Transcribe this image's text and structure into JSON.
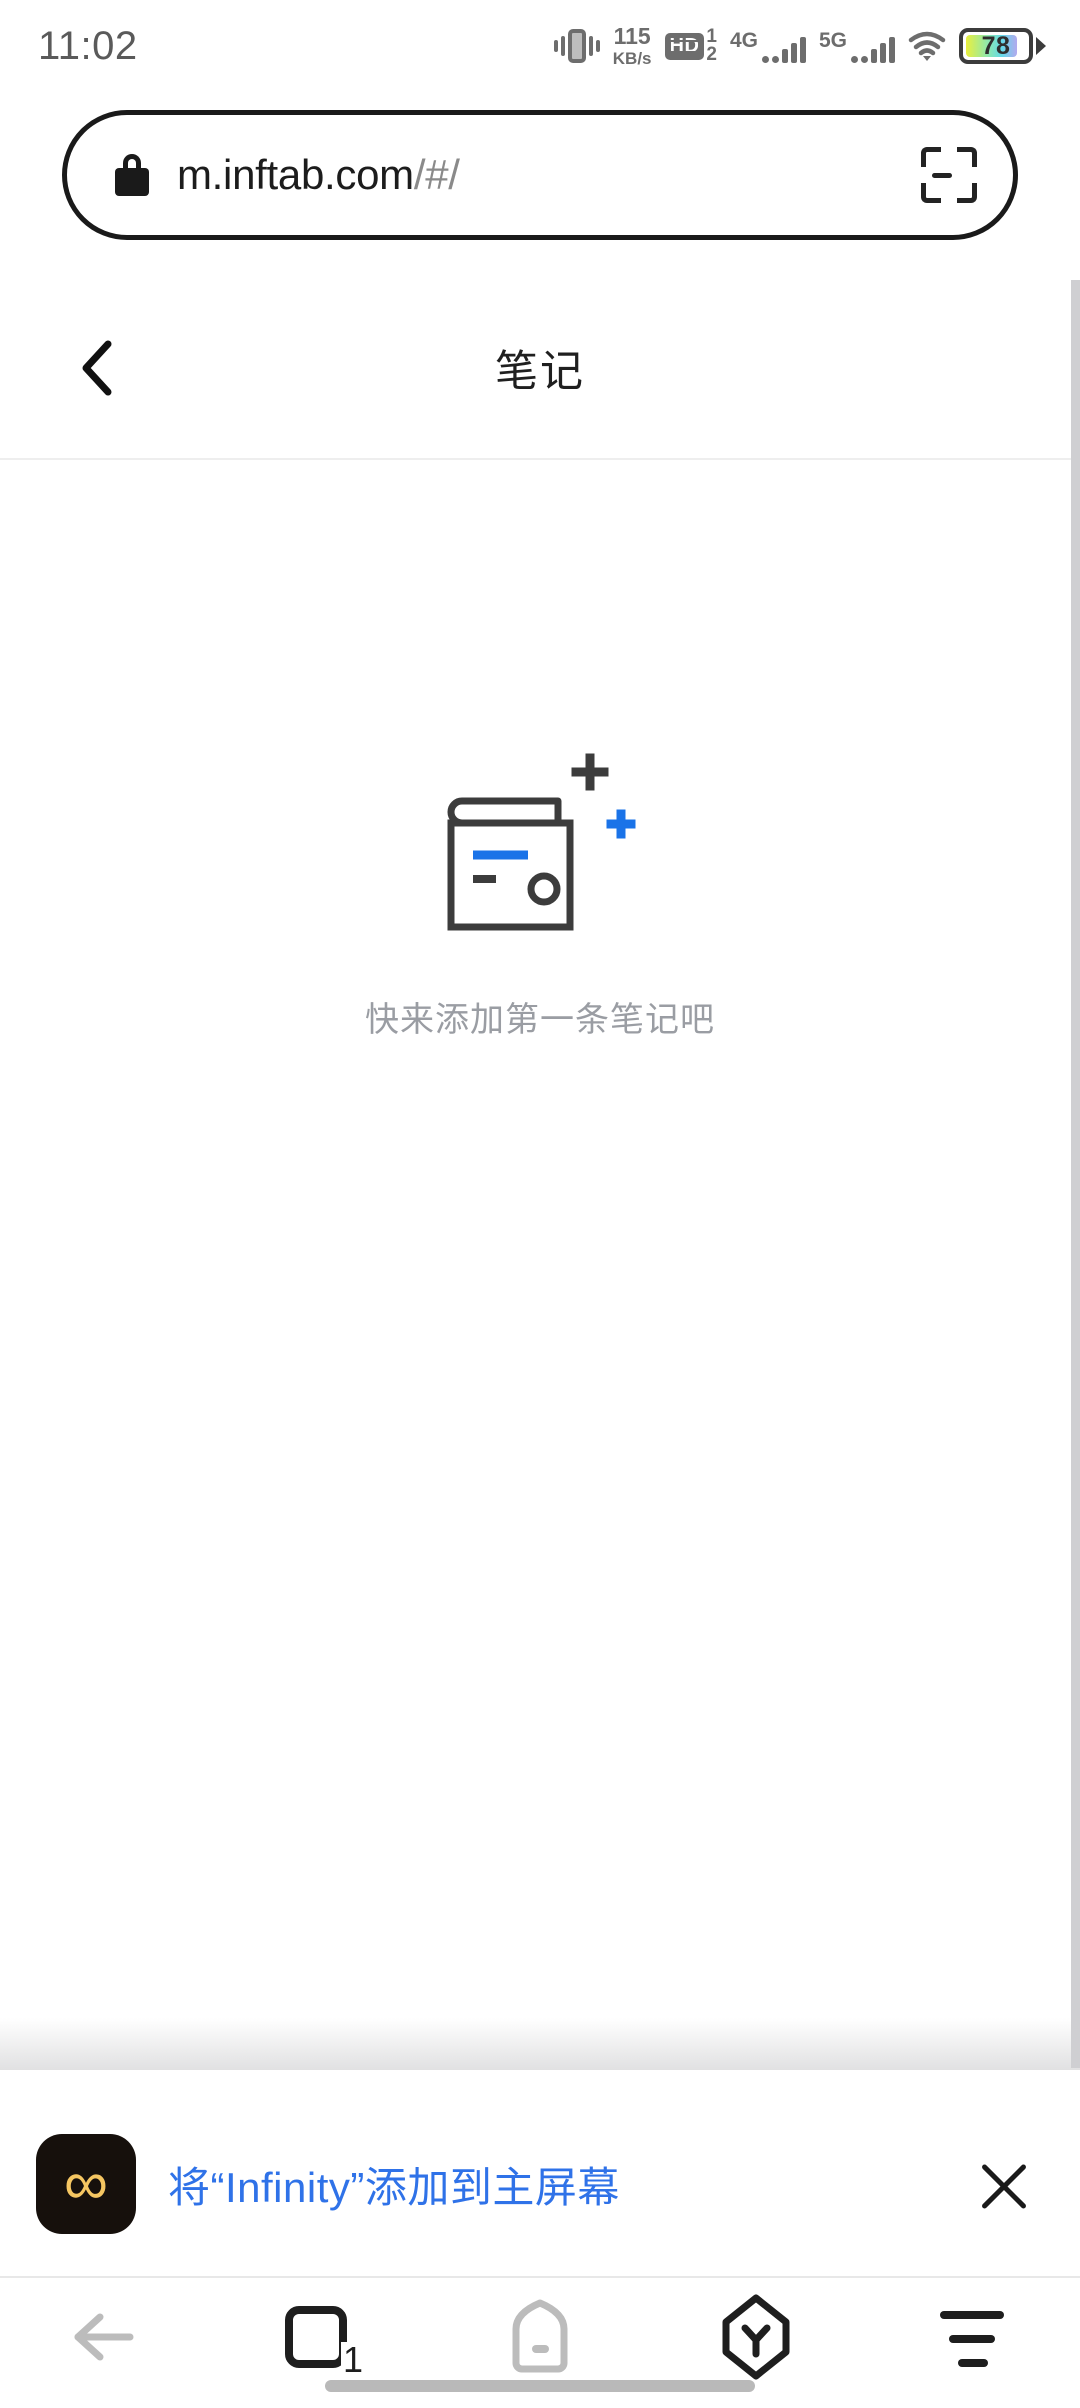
{
  "status_bar": {
    "time": "11:02",
    "network_speed_value": "115",
    "network_speed_unit": "KB/s",
    "hd_label": "HD",
    "hd_sim_top": "1",
    "hd_sim_bottom": "2",
    "sim1_network": "4G",
    "sim2_network": "5G",
    "battery_percent": "78",
    "icons": [
      "vibrate-icon",
      "network-speed-icon",
      "hd-voice-icon",
      "signal-4g-icon",
      "signal-5g-icon",
      "wifi-icon",
      "battery-icon"
    ]
  },
  "url_bar": {
    "lock_icon": "lock-icon",
    "domain": "m.inftab.com",
    "path": "/#/",
    "scan_icon": "scan-qr-icon"
  },
  "page": {
    "back_icon": "back-chevron-icon",
    "title": "笔记",
    "empty_state": {
      "illustration": "empty-notebook-icon",
      "message": "快来添加第一条笔记吧",
      "accent_color": "#1a73e8",
      "line_color": "#3c3c3c",
      "text_color": "#9a9da3"
    }
  },
  "a2hs_banner": {
    "app_icon": "infinity-app-icon",
    "app_icon_glyph": "∞",
    "app_icon_bg": "#16100c",
    "app_icon_fg": "#f5c662",
    "message": "将“Infinity”添加到主屏幕",
    "message_color": "#2f72e8",
    "close_icon": "close-icon"
  },
  "browser_nav": {
    "back_icon": "back-arrow-icon",
    "tabs_icon": "tabs-icon",
    "tabs_count": "1",
    "home_icon": "home-icon",
    "account_icon": "uc-account-icon",
    "account_glyph": "Y",
    "menu_icon": "menu-icon"
  }
}
